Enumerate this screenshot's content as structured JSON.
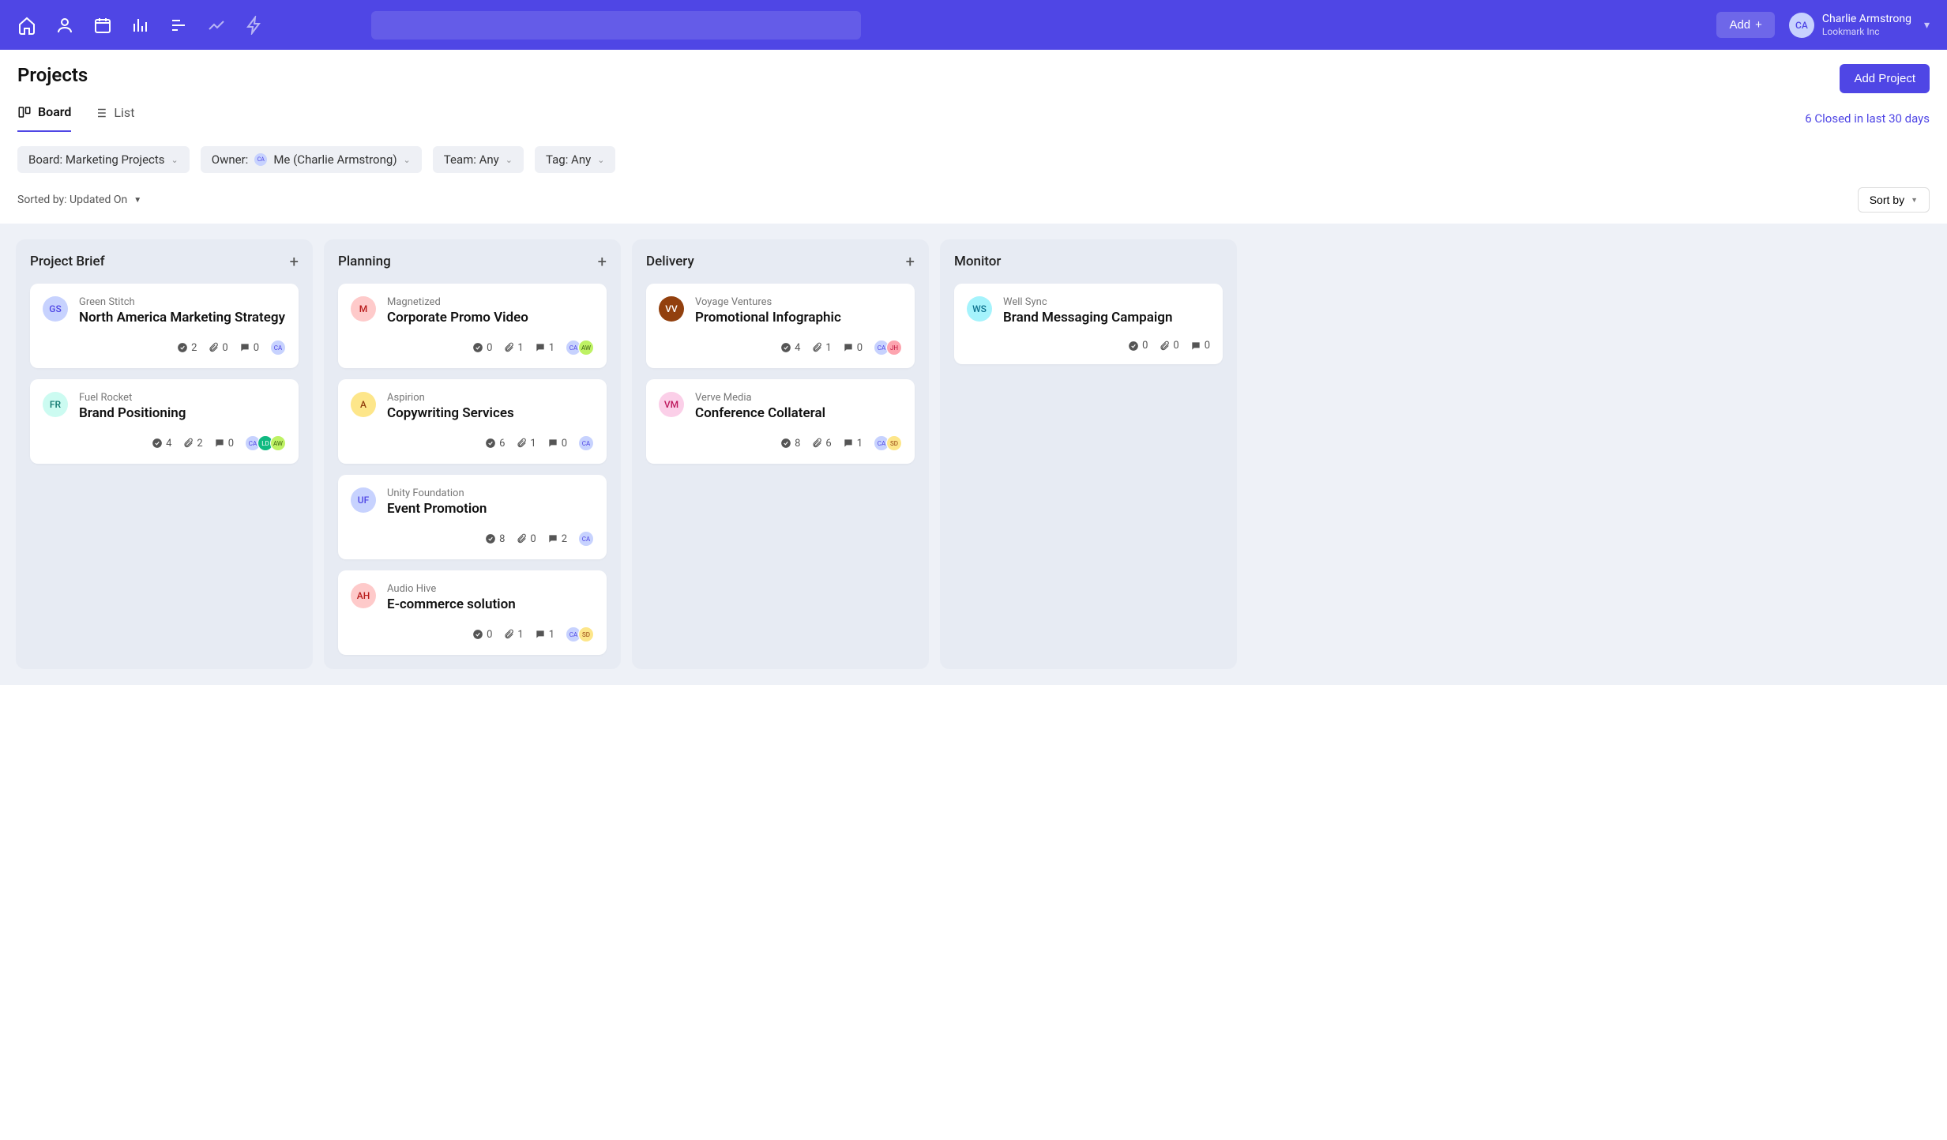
{
  "topbar": {
    "add_label": "Add",
    "user_name": "Charlie Armstrong",
    "user_org": "Lookmark Inc",
    "user_initials": "CA"
  },
  "page": {
    "title": "Projects",
    "add_project_label": "Add Project",
    "closed_link": "6 Closed in last 30 days"
  },
  "tabs": {
    "board": "Board",
    "list": "List"
  },
  "filters": {
    "board": "Board: Marketing Projects",
    "owner_label": "Owner:",
    "owner_value": "Me (Charlie Armstrong)",
    "team": "Team: Any",
    "tag": "Tag: Any"
  },
  "sort": {
    "sorted_by": "Sorted by: Updated On",
    "button": "Sort by"
  },
  "avatar_colors": {
    "CA": {
      "bg": "#c7d2fe",
      "fg": "#4f46e5"
    },
    "GS": {
      "bg": "#c7d2fe",
      "fg": "#4f46e5"
    },
    "FR": {
      "bg": "#ccfbf1",
      "fg": "#0f766e"
    },
    "M": {
      "bg": "#fecaca",
      "fg": "#b91c1c"
    },
    "A": {
      "bg": "#fde68a",
      "fg": "#92400e"
    },
    "UF": {
      "bg": "#c7d2fe",
      "fg": "#4f46e5"
    },
    "AH": {
      "bg": "#fecaca",
      "fg": "#b91c1c"
    },
    "VV": {
      "bg": "#92400e",
      "fg": "#fff"
    },
    "VM": {
      "bg": "#fbcfe8",
      "fg": "#be185d"
    },
    "WS": {
      "bg": "#a5f3fc",
      "fg": "#0e7490"
    },
    "AW": {
      "bg": "#bef264",
      "fg": "#3f6212"
    },
    "LD": {
      "bg": "#10b981",
      "fg": "#fff"
    },
    "JH": {
      "bg": "#fda4af",
      "fg": "#be123c"
    },
    "SD": {
      "bg": "#fde68a",
      "fg": "#92400e"
    }
  },
  "columns": [
    {
      "title": "Project Brief",
      "addable": true,
      "cards": [
        {
          "avatar": "GS",
          "client": "Green Stitch",
          "title": "North America Marketing Strategy",
          "checks": 2,
          "attach": 0,
          "comments": 0,
          "assignees": [
            "CA"
          ]
        },
        {
          "avatar": "FR",
          "client": "Fuel Rocket",
          "title": "Brand Positioning",
          "checks": 4,
          "attach": 2,
          "comments": 0,
          "assignees": [
            "CA",
            "LD",
            "AW"
          ]
        }
      ]
    },
    {
      "title": "Planning",
      "addable": true,
      "cards": [
        {
          "avatar": "M",
          "client": "Magnetized",
          "title": "Corporate Promo Video",
          "checks": 0,
          "attach": 1,
          "comments": 1,
          "assignees": [
            "CA",
            "AW"
          ]
        },
        {
          "avatar": "A",
          "client": "Aspirion",
          "title": "Copywriting Services",
          "checks": 6,
          "attach": 1,
          "comments": 0,
          "assignees": [
            "CA"
          ]
        },
        {
          "avatar": "UF",
          "client": "Unity Foundation",
          "title": "Event Promotion",
          "checks": 8,
          "attach": 0,
          "comments": 2,
          "assignees": [
            "CA"
          ]
        },
        {
          "avatar": "AH",
          "client": "Audio Hive",
          "title": "E-commerce solution",
          "checks": 0,
          "attach": 1,
          "comments": 1,
          "assignees": [
            "CA",
            "SD"
          ]
        }
      ]
    },
    {
      "title": "Delivery",
      "addable": true,
      "cards": [
        {
          "avatar": "VV",
          "client": "Voyage Ventures",
          "title": "Promotional Infographic",
          "checks": 4,
          "attach": 1,
          "comments": 0,
          "assignees": [
            "CA",
            "JH"
          ]
        },
        {
          "avatar": "VM",
          "client": "Verve Media",
          "title": "Conference Collateral",
          "checks": 8,
          "attach": 6,
          "comments": 1,
          "assignees": [
            "CA",
            "SD"
          ]
        }
      ]
    },
    {
      "title": "Monitor",
      "addable": false,
      "cards": [
        {
          "avatar": "WS",
          "client": "Well Sync",
          "title": "Brand Messaging Campaign",
          "checks": 0,
          "attach": 0,
          "comments": 0,
          "assignees": []
        }
      ]
    }
  ]
}
